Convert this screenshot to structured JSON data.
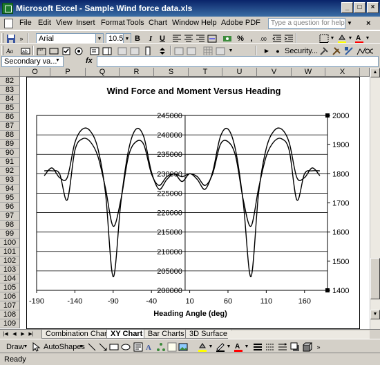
{
  "window": {
    "title": "Microsoft Excel - Sample Wind force data.xls"
  },
  "menu": [
    "File",
    "Edit",
    "View",
    "Insert",
    "Format",
    "Tools",
    "Chart",
    "Window",
    "Help",
    "Adobe PDF"
  ],
  "help_box": {
    "placeholder": "Type a question for help"
  },
  "toolbar": {
    "font_name": "Arial",
    "font_size": "10.5",
    "bold": "B",
    "italic": "I",
    "underline": "U",
    "percent": "%",
    "comma": ",",
    "security_label": "Security..."
  },
  "formula_bar": {
    "name_box": "Secondary va...",
    "fx": "fx"
  },
  "sheet": {
    "columns": [
      "O",
      "P",
      "Q",
      "R",
      "S",
      "T",
      "U",
      "V",
      "W",
      "X"
    ],
    "rows": [
      "82",
      "83",
      "84",
      "85",
      "86",
      "87",
      "88",
      "89",
      "90",
      "91",
      "92",
      "93",
      "94",
      "95",
      "96",
      "97",
      "98",
      "99",
      "100",
      "101",
      "102",
      "103",
      "104",
      "105",
      "106",
      "107",
      "108",
      "109"
    ]
  },
  "tabs": [
    "Combination Chart",
    "XY Chart",
    "Bar Charts",
    "3D Surface"
  ],
  "active_tab": "XY Chart",
  "drawing_toolbar": {
    "draw": "Draw",
    "autoshapes": "AutoShapes"
  },
  "status": "Ready",
  "chart_data": {
    "type": "scatter",
    "title": "Wind Force and Moment Versus Heading",
    "xlabel": "Heading Angle (deg)",
    "ylabel": "",
    "y2label": "",
    "xlim": [
      -190,
      190
    ],
    "ylim": [
      200000,
      245000
    ],
    "y2lim": [
      1400,
      2000
    ],
    "xticks": [
      -190,
      -140,
      -90,
      -40,
      10,
      60,
      110,
      160
    ],
    "yticks": [
      200000,
      205000,
      210000,
      215000,
      220000,
      225000,
      230000,
      235000,
      240000,
      245000
    ],
    "y2ticks": [
      1400,
      1500,
      1600,
      1700,
      1800,
      1900,
      2000
    ],
    "grid": "horizontal",
    "legend": "none",
    "series": [
      {
        "axis": "primary",
        "x": [
          -180,
          -170,
          -160,
          -150,
          -140,
          -130,
          -120,
          -110,
          -100,
          -90,
          -80,
          -70,
          -60,
          -50,
          -40,
          -30,
          -20,
          -10,
          0,
          10,
          20,
          30,
          40,
          50,
          60,
          70,
          80,
          90,
          100,
          110,
          120,
          130,
          140,
          150,
          160,
          170,
          180
        ],
        "y": [
          229500,
          231500,
          229000,
          229000,
          238000,
          241500,
          241000,
          236500,
          225000,
          203500,
          222500,
          236000,
          241500,
          239500,
          230500,
          226000,
          228500,
          230000,
          228000,
          230000,
          228500,
          226000,
          230500,
          239500,
          241500,
          236000,
          222500,
          203500,
          225000,
          236500,
          241000,
          241500,
          238000,
          229000,
          229000,
          231500,
          229500
        ]
      },
      {
        "axis": "secondary",
        "x": [
          -180,
          -170,
          -160,
          -150,
          -140,
          -130,
          -120,
          -110,
          -100,
          -90,
          -80,
          -70,
          -60,
          -50,
          -40,
          -30,
          -20,
          -10,
          0,
          10,
          20,
          30,
          40,
          50,
          60,
          70,
          80,
          90,
          100,
          110,
          120,
          130,
          140,
          150,
          160,
          170,
          180
        ],
        "y": [
          1810,
          1810,
          1800,
          1710,
          1880,
          1920,
          1910,
          1860,
          1750,
          1620,
          1710,
          1860,
          1910,
          1900,
          1800,
          1760,
          1790,
          1800,
          1790,
          1800,
          1790,
          1760,
          1800,
          1900,
          1910,
          1860,
          1710,
          1620,
          1750,
          1860,
          1910,
          1920,
          1880,
          1710,
          1800,
          1810,
          1810
        ]
      }
    ]
  }
}
